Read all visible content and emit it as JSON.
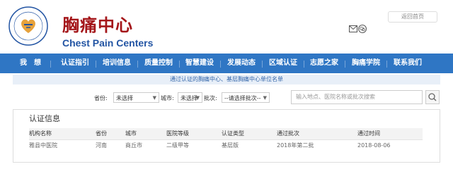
{
  "header": {
    "title_cn": "胸痛中心",
    "title_en": "Chest Pain Centers",
    "home_link": "返回首页"
  },
  "nav": {
    "items": [
      "我　想",
      "认证指引",
      "培训信息",
      "质量控制",
      "智慧建设",
      "发展动态",
      "区域认证",
      "志愿之家",
      "胸痛学院",
      "联系我们"
    ]
  },
  "subtitle": "通过认证的胸痛中心、基层胸痛中心单位名单",
  "filters": {
    "province_label": "省份:",
    "province_value": "未选择",
    "city_label": "城市:",
    "city_value": "未选择",
    "batch_label": "批次:",
    "batch_value": "--请选择批次--",
    "search_placeholder": "输入地点、医院名称或批次搜索"
  },
  "panel": {
    "title": "认证信息",
    "columns": [
      "机构名称",
      "省份",
      "城市",
      "医院等级",
      "认证类型",
      "通过批次",
      "通过时间"
    ],
    "rows": [
      [
        "雅县中医院",
        "河南",
        "商丘市",
        "二级甲等",
        "基层版",
        "2018年第二批",
        "2018-08-06"
      ]
    ]
  },
  "colors": {
    "brand_red": "#a4161a",
    "brand_blue": "#2254a3",
    "nav_blue": "#2f76c4"
  }
}
